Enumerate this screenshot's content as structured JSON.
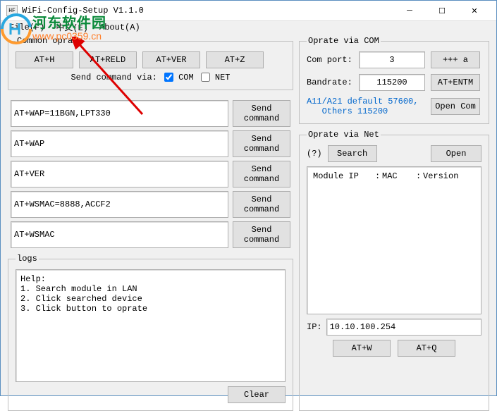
{
  "window": {
    "title": "WiFi-Config-Setup V1.1.0"
  },
  "menu": {
    "file": "File(F)",
    "chinese": "中文(E)",
    "about": "About(A)"
  },
  "watermark": {
    "text": "河东软件园",
    "url": "www.pc0359.cn"
  },
  "common": {
    "legend": "Common oprate",
    "btns": [
      "AT+H",
      "AT+RELD",
      "AT+VER",
      "AT+Z"
    ],
    "sendvia": {
      "label": "Send command via:",
      "com": "COM",
      "net": "NET"
    }
  },
  "commands": {
    "send_label": "Send command",
    "rows": [
      {
        "value": "AT+WAP=11BGN,LPT330"
      },
      {
        "value": "AT+WAP"
      },
      {
        "value": "AT+VER"
      },
      {
        "value": "AT+WSMAC=8888,ACCF2"
      },
      {
        "value": "AT+WSMAC"
      }
    ]
  },
  "logs": {
    "legend": "logs",
    "text": "Help:\n1. Search module in LAN\n2. Click searched device\n3. Click button to oprate",
    "clear": "Clear"
  },
  "com": {
    "legend": "Oprate via COM",
    "port_label": "Com port:",
    "port": "3",
    "baud_label": "Bandrate:",
    "baud": "115200",
    "hint": "A11/A21 default 57600,\n   Others 115200",
    "btn_a": "+++ a",
    "btn_entm": "AT+ENTM",
    "btn_open": "Open Com"
  },
  "net": {
    "legend": "Oprate via Net",
    "q": "(?)",
    "search": "Search",
    "open": "Open",
    "hdr": {
      "ip": "Module IP",
      "mac": "MAC",
      "ver": "Version"
    },
    "ip_label": "IP:",
    "ip": "10.10.100.254",
    "atw": "AT+W",
    "atq": "AT+Q"
  }
}
